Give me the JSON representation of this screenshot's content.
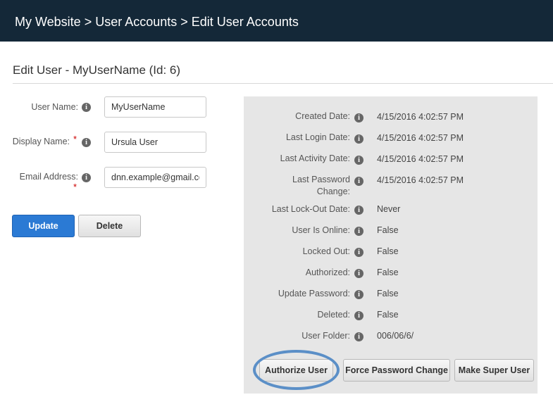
{
  "header": {
    "breadcrumb": "My Website > User Accounts > Edit User Accounts"
  },
  "page": {
    "title": "Edit User - MyUserName (Id: 6)"
  },
  "form": {
    "username_label": "User Name:",
    "username_value": "MyUserName",
    "displayname_label": "Display Name:",
    "displayname_value": "Ursula User",
    "email_label": "Email Address:",
    "email_value": "dnn.example@gmail.co",
    "required_marker": "*",
    "info_glyph": "i"
  },
  "actions": {
    "update": "Update",
    "delete": "Delete"
  },
  "stats": {
    "created_date_label": "Created Date:",
    "created_date_value": "4/15/2016 4:02:57 PM",
    "last_login_label": "Last Login Date:",
    "last_login_value": "4/15/2016 4:02:57 PM",
    "last_activity_label": "Last Activity Date:",
    "last_activity_value": "4/15/2016 4:02:57 PM",
    "last_password_label_line1": "Last Password",
    "last_password_label_line2": "Change:",
    "last_password_value": "4/15/2016 4:02:57 PM",
    "last_lockout_label": "Last Lock-Out Date:",
    "last_lockout_value": "Never",
    "online_label": "User Is Online:",
    "online_value": "False",
    "locked_label": "Locked Out:",
    "locked_value": "False",
    "authorized_label": "Authorized:",
    "authorized_value": "False",
    "update_password_label": "Update Password:",
    "update_password_value": "False",
    "deleted_label": "Deleted:",
    "deleted_value": "False",
    "folder_label": "User Folder:",
    "folder_value": "006/06/6/"
  },
  "panel_actions": {
    "authorize": "Authorize User",
    "force_password": "Force Password Change",
    "make_super": "Make Super User"
  },
  "colors": {
    "header_bg": "#142838",
    "primary": "#2b7ad4",
    "panel_bg": "#e6e6e6",
    "highlight": "#5b8fc7",
    "required": "#cc0000"
  }
}
